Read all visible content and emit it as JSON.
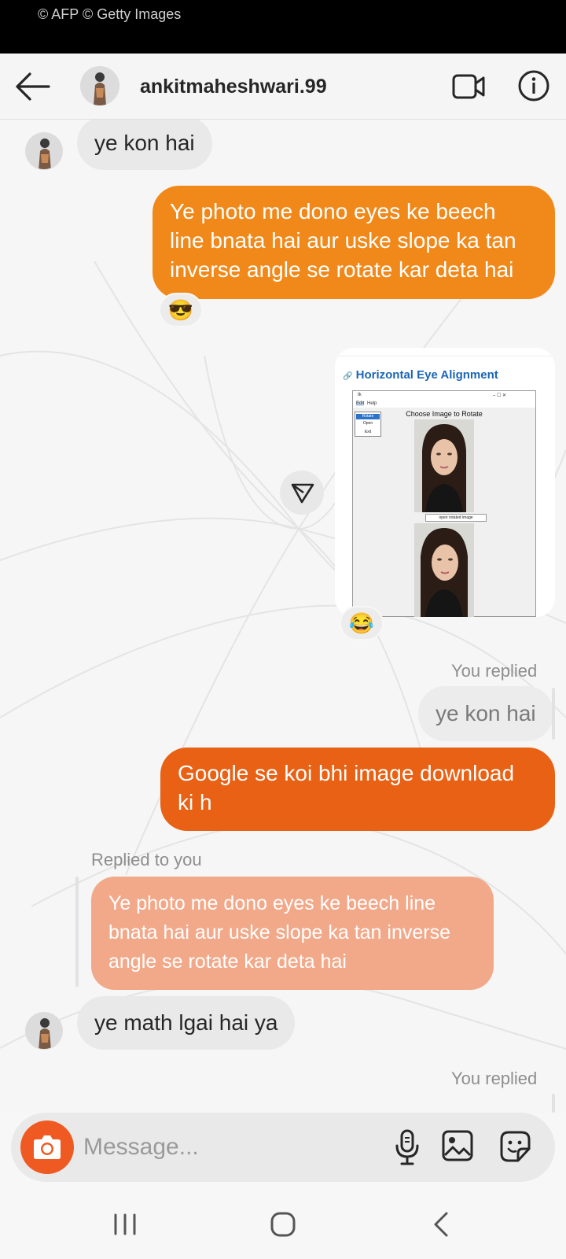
{
  "status_bar": {
    "credit": "© AFP © Getty Images"
  },
  "header": {
    "username": "ankitmaheshwari.99",
    "icons": {
      "back": "arrow-left-icon",
      "video": "video-call-icon",
      "info": "info-icon"
    }
  },
  "messages": {
    "m1": {
      "text": "ye kon hai"
    },
    "m2": {
      "lines": [
        "Ye photo me dono eyes ke beech",
        "line bnata hai aur uske slope ka tan",
        "inverse angle se rotate kar deta hai"
      ],
      "color": "#f0891a",
      "reaction": "😎"
    },
    "shared_card": {
      "link_icon": "🔗",
      "title": "Horizontal Eye Alignment",
      "window_title": "tk",
      "window_controls": "–   ☐   ✕",
      "menu_file": "Edit",
      "menu_help": "Help",
      "menu_items": [
        "Rotate",
        "Open",
        "Exit"
      ],
      "label": "Choose Image to Rotate",
      "button": "open rotated image",
      "reaction": "😂"
    },
    "m3": {
      "meta": "You replied",
      "quoted": "ye kon hai"
    },
    "m4": {
      "lines": [
        "Google se koi bhi image download",
        "ki h"
      ],
      "color": "#e86114"
    },
    "m5": {
      "meta": "Replied to you",
      "lines": [
        "Ye photo me dono eyes ke beech line",
        "bnata hai aur uske slope ka tan inverse",
        "angle se rotate kar deta hai"
      ],
      "color": "#f2a98a"
    },
    "m6": {
      "text": "ye math lgai hai ya"
    },
    "m7": {
      "meta": "You replied"
    }
  },
  "composer": {
    "placeholder": "Message...",
    "icons": {
      "camera": "camera-icon",
      "mic": "microphone-icon",
      "gallery": "gallery-icon",
      "sticker": "sticker-icon"
    }
  },
  "navbar": {
    "icons": [
      "recents-icon",
      "home-icon",
      "back-icon"
    ]
  }
}
